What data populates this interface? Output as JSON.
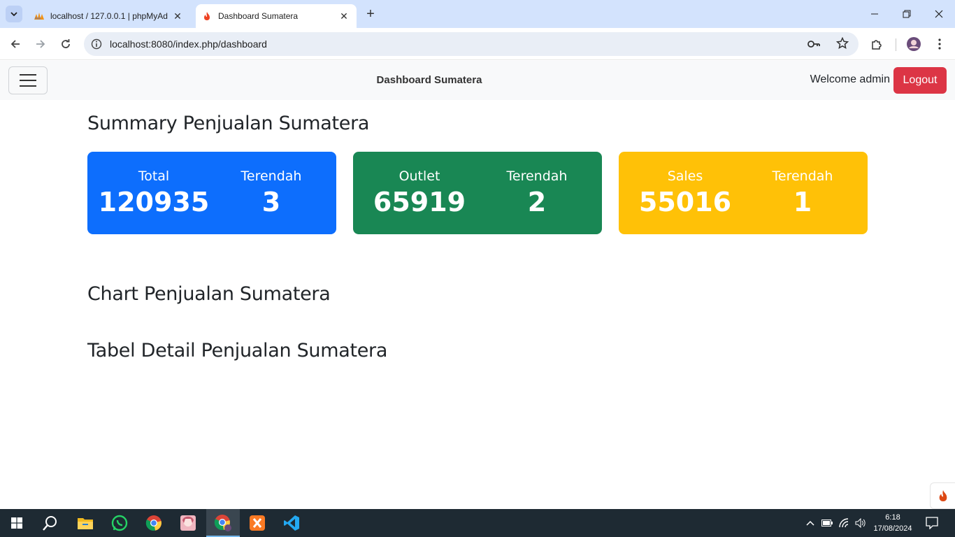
{
  "browser": {
    "tabs": [
      {
        "title": "localhost / 127.0.0.1 | phpMyAd",
        "favicon": "phpmyadmin-icon",
        "active": false
      },
      {
        "title": "Dashboard Sumatera",
        "favicon": "codeigniter-flame-icon",
        "active": true
      }
    ],
    "url": "localhost:8080/index.php/dashboard"
  },
  "navbar": {
    "brand": "Dashboard Sumatera",
    "welcome": "Welcome admin",
    "logout_label": "Logout"
  },
  "page": {
    "summary_heading": "Summary Penjualan Sumatera",
    "chart_heading": "Chart Penjualan Sumatera",
    "table_heading": "Tabel Detail Penjualan Sumatera"
  },
  "cards": [
    {
      "label": "Total",
      "value": "120935",
      "low_label": "Terendah",
      "low_value": "3",
      "color": "#0d6efd"
    },
    {
      "label": "Outlet",
      "value": "65919",
      "low_label": "Terendah",
      "low_value": "2",
      "color": "#198754"
    },
    {
      "label": "Sales",
      "value": "55016",
      "low_label": "Terendah",
      "low_value": "1",
      "color": "#ffc107"
    }
  ],
  "taskbar": {
    "time": "6:18",
    "date": "17/08/2024",
    "apps": [
      "start-icon",
      "search-icon",
      "file-explorer-icon",
      "whatsapp-icon",
      "chrome-icon",
      "anime-avatar-icon",
      "chrome-profile-icon",
      "xampp-icon",
      "vscode-icon"
    ]
  }
}
